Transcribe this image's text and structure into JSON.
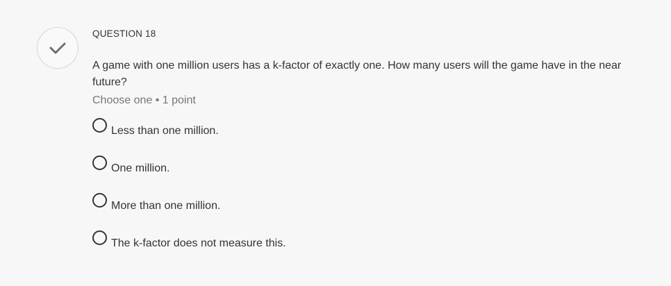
{
  "status": {
    "icon": "checkmark-icon",
    "icon_color": "#6e6e6e",
    "border_color": "#d6d6d6"
  },
  "question": {
    "label": "QUESTION 18",
    "text": "A game with one million users has a k-factor of exactly one. How many users will the game have in the near future?",
    "meta": "Choose one • 1 point"
  },
  "options": [
    {
      "label": "Less than one million.",
      "selected": false
    },
    {
      "label": "One million.",
      "selected": false
    },
    {
      "label": "More than one million.",
      "selected": false
    },
    {
      "label": "The k-factor does not measure this.",
      "selected": false
    }
  ]
}
